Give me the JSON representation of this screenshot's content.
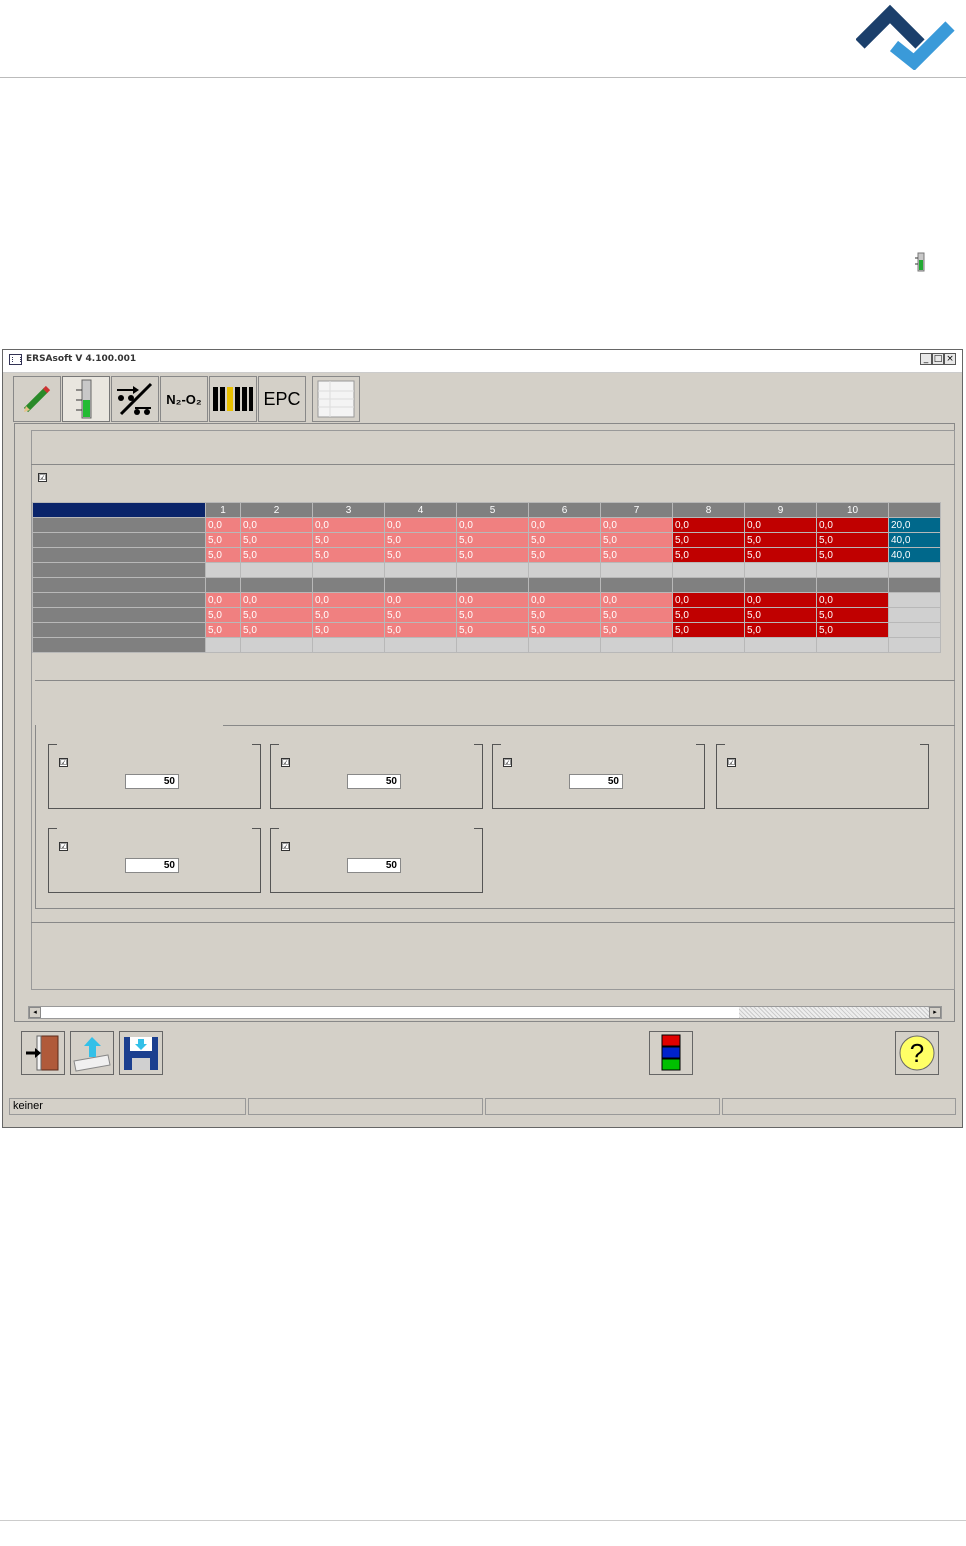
{
  "window": {
    "title": "ERSAsoft V 4.100.001",
    "controls": [
      "_",
      "□",
      "×"
    ]
  },
  "toolbar": {
    "buttons": [
      {
        "name": "pencil-icon"
      },
      {
        "name": "level-bar-icon"
      },
      {
        "name": "conveyor-icon"
      },
      {
        "name": "n2-o2-icon",
        "label": "N₂-O₂"
      },
      {
        "name": "zones-icon"
      },
      {
        "name": "epc-icon",
        "label": "EPC"
      },
      {
        "name": "document-icon"
      }
    ]
  },
  "settings": {
    "enable_checked": "☑"
  },
  "grid": {
    "columns": [
      "1",
      "2",
      "3",
      "4",
      "5",
      "6",
      "7",
      "8",
      "9",
      "10",
      ""
    ],
    "rows": [
      {
        "cells": [
          "0,0",
          "0,0",
          "0,0",
          "0,0",
          "0,0",
          "0,0",
          "0,0",
          "0,0",
          "0,0",
          "0,0",
          "20,0"
        ]
      },
      {
        "cells": [
          "5,0",
          "5,0",
          "5,0",
          "5,0",
          "5,0",
          "5,0",
          "5,0",
          "5,0",
          "5,0",
          "5,0",
          "40,0"
        ]
      },
      {
        "cells": [
          "5,0",
          "5,0",
          "5,0",
          "5,0",
          "5,0",
          "5,0",
          "5,0",
          "5,0",
          "5,0",
          "5,0",
          "40,0"
        ]
      },
      {
        "cells": [
          "",
          "",
          "",
          "",
          "",
          "",
          "",
          "",
          "",
          "",
          ""
        ]
      },
      {
        "cells": [
          "",
          "",
          "",
          "",
          "",
          "",
          "",
          "",
          "",
          "",
          ""
        ]
      },
      {
        "cells": [
          "0,0",
          "0,0",
          "0,0",
          "0,0",
          "0,0",
          "0,0",
          "0,0",
          "0,0",
          "0,0",
          "0,0",
          ""
        ]
      },
      {
        "cells": [
          "5,0",
          "5,0",
          "5,0",
          "5,0",
          "5,0",
          "5,0",
          "5,0",
          "5,0",
          "5,0",
          "5,0",
          ""
        ]
      },
      {
        "cells": [
          "5,0",
          "5,0",
          "5,0",
          "5,0",
          "5,0",
          "5,0",
          "5,0",
          "5,0",
          "5,0",
          "5,0",
          ""
        ]
      },
      {
        "cells": [
          "",
          "",
          "",
          "",
          "",
          "",
          "",
          "",
          "",
          "",
          ""
        ]
      }
    ],
    "colors": {
      "pink": "#f08080",
      "red": "#c00000",
      "blue": "#00688b",
      "header": "#808080",
      "corner": "#0a246a"
    }
  },
  "groups": [
    {
      "value": "50"
    },
    {
      "value": "50"
    },
    {
      "value": "50"
    },
    {
      "value": ""
    },
    {
      "value": "50"
    },
    {
      "value": "50"
    }
  ],
  "bottom_buttons": [
    {
      "name": "exit-door-icon"
    },
    {
      "name": "upload-icon"
    },
    {
      "name": "save-disk-icon"
    },
    {
      "name": "color-bars-icon"
    },
    {
      "name": "help-icon",
      "label": "?"
    }
  ],
  "statusbar": {
    "cells": [
      "keiner",
      "",
      "",
      "",
      ""
    ]
  }
}
